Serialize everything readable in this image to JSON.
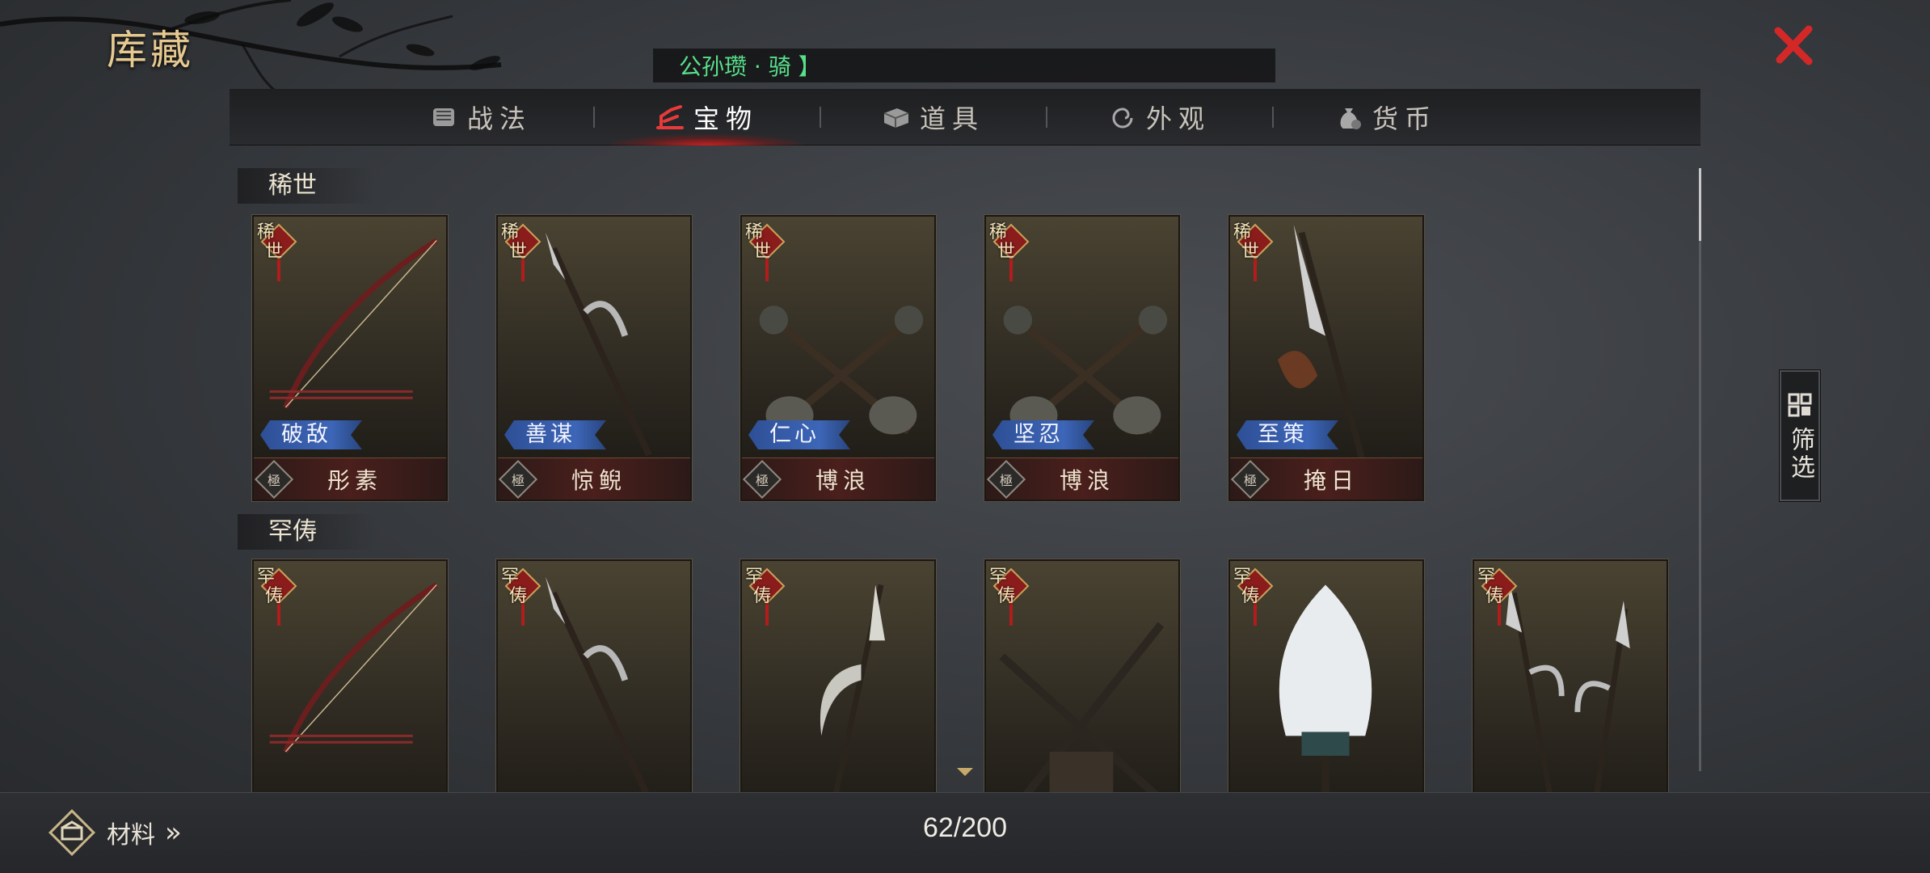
{
  "header": {
    "title": "库藏",
    "banner_text": "公孙瓒 · 骑 】",
    "close_icon": "close-icon"
  },
  "tabs": [
    {
      "label": "战法",
      "icon": "scroll-icon",
      "active": false
    },
    {
      "label": "宝物",
      "icon": "treasure-icon",
      "active": true
    },
    {
      "label": "道具",
      "icon": "box-icon",
      "active": false
    },
    {
      "label": "外观",
      "icon": "swirl-icon",
      "active": false
    },
    {
      "label": "货币",
      "icon": "money-bag-icon",
      "active": false
    }
  ],
  "sections": [
    {
      "label": "稀世",
      "items": [
        {
          "rarity": "稀世",
          "tag": "破敌",
          "grade": "極",
          "owner": "彤素",
          "weapon": "bow"
        },
        {
          "rarity": "稀世",
          "tag": "善谋",
          "grade": "極",
          "owner": "惊鲵",
          "weapon": "halberd"
        },
        {
          "rarity": "稀世",
          "tag": "仁心",
          "grade": "極",
          "owner": "博浪",
          "weapon": "hammers"
        },
        {
          "rarity": "稀世",
          "tag": "坚忍",
          "grade": "極",
          "owner": "博浪",
          "weapon": "hammers"
        },
        {
          "rarity": "稀世",
          "tag": "至策",
          "grade": "極",
          "owner": "掩日",
          "weapon": "glaive"
        }
      ]
    },
    {
      "label": "罕俦",
      "items": [
        {
          "rarity": "罕俦",
          "weapon": "bow"
        },
        {
          "rarity": "罕俦",
          "weapon": "spear"
        },
        {
          "rarity": "罕俦",
          "weapon": "crescent-spear"
        },
        {
          "rarity": "罕俦",
          "weapon": "crossed-swords"
        },
        {
          "rarity": "罕俦",
          "weapon": "feather-fan"
        },
        {
          "rarity": "罕俦",
          "weapon": "halberds"
        }
      ]
    }
  ],
  "filter": {
    "label": "筛选",
    "icon": "filter-grid-icon"
  },
  "footer": {
    "materials_label": "材料",
    "materials_arrow": "»",
    "count_text": "62/200"
  },
  "colors": {
    "accent_red": "#d42828",
    "banner_green": "#58e08a",
    "title_gold": "#e6c98f",
    "tag_blue": "#3d66b8"
  }
}
